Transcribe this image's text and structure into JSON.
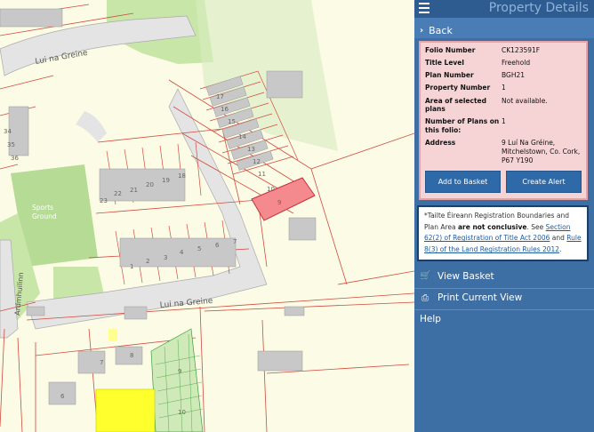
{
  "map": {
    "road_labels": [
      "Lui na Greine",
      "Lui na Greine",
      "Ardmhuilinn"
    ],
    "area_label": "Sports Ground",
    "house_numbers": {
      "row_right": [
        "17",
        "16",
        "15",
        "14",
        "13",
        "12",
        "11",
        "10",
        "9"
      ],
      "row_mid": [
        "23",
        "22",
        "21",
        "20",
        "19",
        "18"
      ],
      "row_lower": [
        "1",
        "2",
        "3",
        "4",
        "5",
        "6",
        "7"
      ],
      "row_left": [
        "34",
        "35",
        "36"
      ],
      "row_bottom": [
        "7",
        "8",
        "6",
        "9",
        "10"
      ]
    },
    "highlight_color": "#f48a8e",
    "green_area_color": "#b6db95",
    "yellow_area_color": "#ffff2e",
    "boundary_color": "#d14a3e"
  },
  "panel": {
    "title": "Property Details",
    "back_label": "Back",
    "details": [
      {
        "key": "Folio Number",
        "value": "CK123591F"
      },
      {
        "key": "Title Level",
        "value": "Freehold"
      },
      {
        "key": "Plan Number",
        "value": "BGH21"
      },
      {
        "key": "Property Number",
        "value": "1"
      },
      {
        "key": "Area of selected plans",
        "value": "Not available."
      },
      {
        "key": "Number of Plans on this folio:",
        "value": "1"
      },
      {
        "key": "Address",
        "value": "9 Luí Na Gréine, Mitchelstown, Co. Cork, P67 Y190"
      }
    ],
    "add_to_basket_label": "Add to Basket",
    "create_alert_label": "Create Alert",
    "note": {
      "prefix": "*Tailte Éireann Registration Boundaries and Plan Area ",
      "bold": "are not conclusive",
      "mid": ". See ",
      "link1": "Section 62(2) of Registration of Title Act 2006",
      "and": " and ",
      "link2": "Rule 8(3) of the Land Registration Rules 2012",
      "end": "."
    },
    "view_basket_label": "View Basket",
    "print_label": "Print Current View",
    "help_label": "Help"
  }
}
